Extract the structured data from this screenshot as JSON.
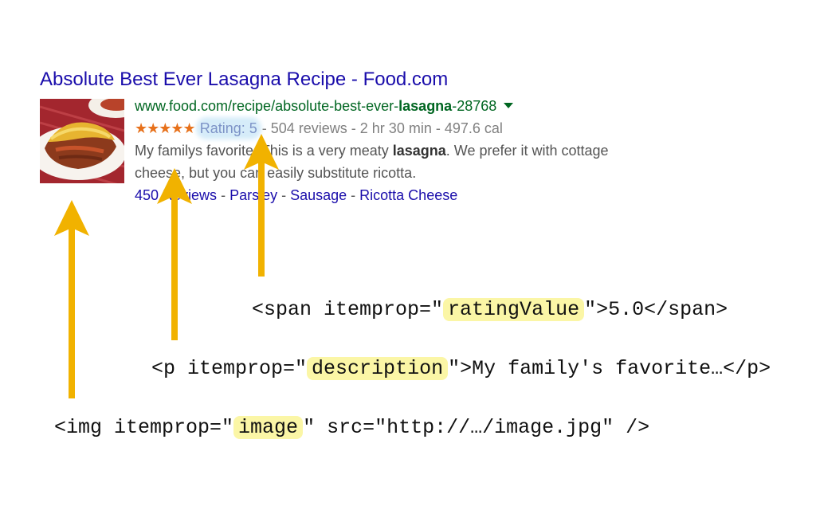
{
  "result": {
    "title": "Absolute Best Ever Lasagna Recipe - Food.com",
    "url_prefix": "www.food.com/recipe/absolute-best-ever-",
    "url_bold": "lasagna",
    "url_suffix": "-28768",
    "stars": "★★★★★",
    "rating": "Rating: 5",
    "meta": " - 504 reviews - 2 hr 30 min - 497.6 cal",
    "snippet_1a": "My familys favorite. This is a very meaty ",
    "snippet_1b": "lasagna",
    "snippet_1c": ". We prefer it with cottage",
    "snippet_2": "cheese, but you can easily substitute ricotta.",
    "links": [
      "450 Reviews",
      "Parsley",
      "Sausage",
      "Ricotta Cheese"
    ],
    "link_sep": " - "
  },
  "code": {
    "line1_pre": "<span itemprop=\"",
    "line1_hl": "ratingValue",
    "line1_post": "\">5.0</span>",
    "line2_pre": "<p itemprop=\"",
    "line2_hl": "description",
    "line2_post": "\">My family's favorite…</p>",
    "line3_pre": "<img itemprop=\"",
    "line3_hl": "image",
    "line3_post": "\" src=\"http://…/image.jpg\" />"
  },
  "colors": {
    "title": "#1a0dab",
    "url": "#006621",
    "stars": "#e7711b",
    "arrow": "#f1b200",
    "highlight": "#fbf6a6"
  }
}
